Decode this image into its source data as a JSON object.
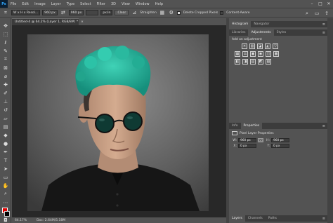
{
  "app": {
    "logo": "Ps"
  },
  "menu": [
    "File",
    "Edit",
    "Image",
    "Layer",
    "Type",
    "Select",
    "Filter",
    "3D",
    "View",
    "Window",
    "Help"
  ],
  "window_controls": [
    "–",
    "□",
    "✕"
  ],
  "options_bar": {
    "ratio_select": "W x H x Resol...",
    "width_value": "960 px",
    "height_value": "960 px",
    "resolution_value": "",
    "resolution_unit": "px/in",
    "clear_label": "Clear",
    "straighten_label": "Straighten",
    "delete_cropped_label": "Delete Cropped Pixels",
    "content_aware_label": "Content-Aware"
  },
  "document": {
    "tab_title": "Untitled-4 @ 64.2% (Layer 1, RGB/8#) *",
    "close": "×",
    "zoom": "64.17%",
    "doc_info": "Doc: 2.64M/5.18M"
  },
  "panels": {
    "top_tabs": [
      "Histogram",
      "Navigator"
    ],
    "adj_tabs": [
      "Libraries",
      "Adjustments",
      "Styles"
    ],
    "adj_title": "Add an adjustment",
    "adj_row1": [
      "☀",
      "▥",
      "◪",
      "◭",
      "▽"
    ],
    "adj_row2": [
      "▦",
      "⚖",
      "▣",
      "◉",
      "◫",
      "▩"
    ],
    "adj_row3": [
      "◧",
      "◨",
      "▤",
      "◩",
      "▧"
    ],
    "props_tabs": [
      "Info",
      "Properties"
    ],
    "props_title": "Pixel Layer Properties",
    "props": {
      "w_label": "W:",
      "w_value": "960 px",
      "h_label": "H:",
      "h_value": "960 px",
      "x_label": "X:",
      "x_value": "0 px",
      "y_label": "Y:",
      "y_value": "0 px",
      "link": "GO"
    },
    "layers_tabs": [
      "Layers",
      "Channels",
      "Paths"
    ]
  },
  "colors": {
    "foreground": "#e00000",
    "background": "#000000",
    "hair": "#1fb59c"
  }
}
